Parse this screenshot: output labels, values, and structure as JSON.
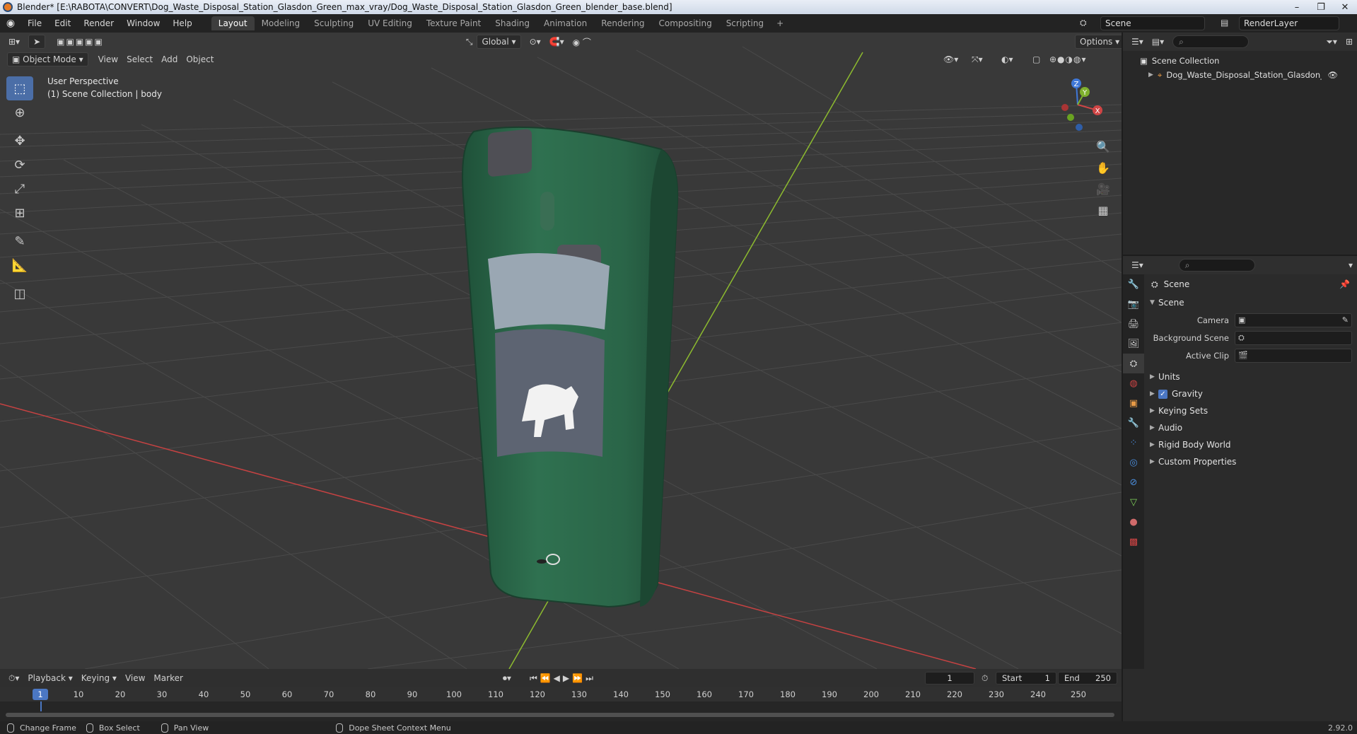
{
  "window": {
    "title": "Blender* [E:\\RABOTA\\CONVERT\\Dog_Waste_Disposal_Station_Glasdon_Green_max_vray/Dog_Waste_Disposal_Station_Glasdon_Green_blender_base.blend]",
    "controls": [
      "–",
      "❐",
      "✕"
    ]
  },
  "menu": {
    "items": [
      "File",
      "Edit",
      "Render",
      "Window",
      "Help"
    ]
  },
  "workspaces": {
    "tabs": [
      "Layout",
      "Modeling",
      "Sculpting",
      "UV Editing",
      "Texture Paint",
      "Shading",
      "Animation",
      "Rendering",
      "Compositing",
      "Scripting"
    ],
    "active": "Layout",
    "add": "+"
  },
  "scene_selector": {
    "value": "Scene"
  },
  "view_layer_selector": {
    "value": "RenderLayer"
  },
  "viewport": {
    "mode": "Object Mode",
    "menus": [
      "View",
      "Select",
      "Add",
      "Object"
    ],
    "transform_orientation": "Global",
    "options_label": "Options",
    "overlay_line1": "User Perspective",
    "overlay_line2": "(1) Scene Collection | body",
    "axis_labels": {
      "x": "X",
      "y": "Y",
      "z": "Z"
    },
    "colors": {
      "background": "#393939",
      "x_axis": "#c64242",
      "y_axis": "#8dbb2f",
      "object": "#2c6a4b",
      "accent": "#4b77c3"
    }
  },
  "outliner": {
    "root": "Scene Collection",
    "items": [
      {
        "name": "Dog_Waste_Disposal_Station_Glasdon_Greer"
      }
    ]
  },
  "properties": {
    "context_title": "Scene",
    "panel_title": "Scene",
    "fields": [
      {
        "label": "Camera",
        "value": ""
      },
      {
        "label": "Background Scene",
        "value": ""
      },
      {
        "label": "Active Clip",
        "value": ""
      }
    ],
    "sections": [
      {
        "label": "Units",
        "checkbox": false
      },
      {
        "label": "Gravity",
        "checkbox": true
      },
      {
        "label": "Keying Sets",
        "checkbox": false
      },
      {
        "label": "Audio",
        "checkbox": false
      },
      {
        "label": "Rigid Body World",
        "checkbox": false
      },
      {
        "label": "Custom Properties",
        "checkbox": false
      }
    ]
  },
  "timeline": {
    "menus": [
      "Playback",
      "Keying",
      "View",
      "Marker"
    ],
    "current_frame": "1",
    "start_label": "Start",
    "start_value": "1",
    "end_label": "End",
    "end_value": "250",
    "ruler": [
      "1",
      "10",
      "20",
      "30",
      "40",
      "50",
      "60",
      "70",
      "80",
      "90",
      "100",
      "110",
      "120",
      "130",
      "140",
      "150",
      "160",
      "170",
      "180",
      "190",
      "200",
      "210",
      "220",
      "230",
      "240",
      "250"
    ]
  },
  "statusbar": {
    "items": [
      "Change Frame",
      "Box Select",
      "Pan View",
      "Dope Sheet Context Menu"
    ],
    "version": "2.92.0"
  }
}
